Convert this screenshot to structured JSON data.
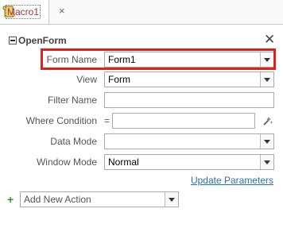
{
  "tab": {
    "label": "Macro1",
    "close": "×"
  },
  "action": {
    "name": "OpenForm",
    "delete": "✕",
    "arguments": [
      {
        "label": "Form Name",
        "value": "Form1",
        "type": "dropdown"
      },
      {
        "label": "View",
        "value": "Form",
        "type": "dropdown"
      },
      {
        "label": "Filter Name",
        "value": "",
        "type": "text"
      },
      {
        "label": "Where Condition",
        "prefix": "=",
        "value": "",
        "type": "expression"
      },
      {
        "label": "Data Mode",
        "value": "",
        "type": "dropdown"
      },
      {
        "label": "Window Mode",
        "value": "Normal",
        "type": "dropdown"
      }
    ],
    "update_parameters": "Update Parameters"
  },
  "add_action": {
    "plus": "+",
    "placeholder": "Add New Action"
  },
  "colors": {
    "highlight": "#e0201d",
    "tab_text": "#a4373a",
    "link": "#2a6ebb"
  }
}
